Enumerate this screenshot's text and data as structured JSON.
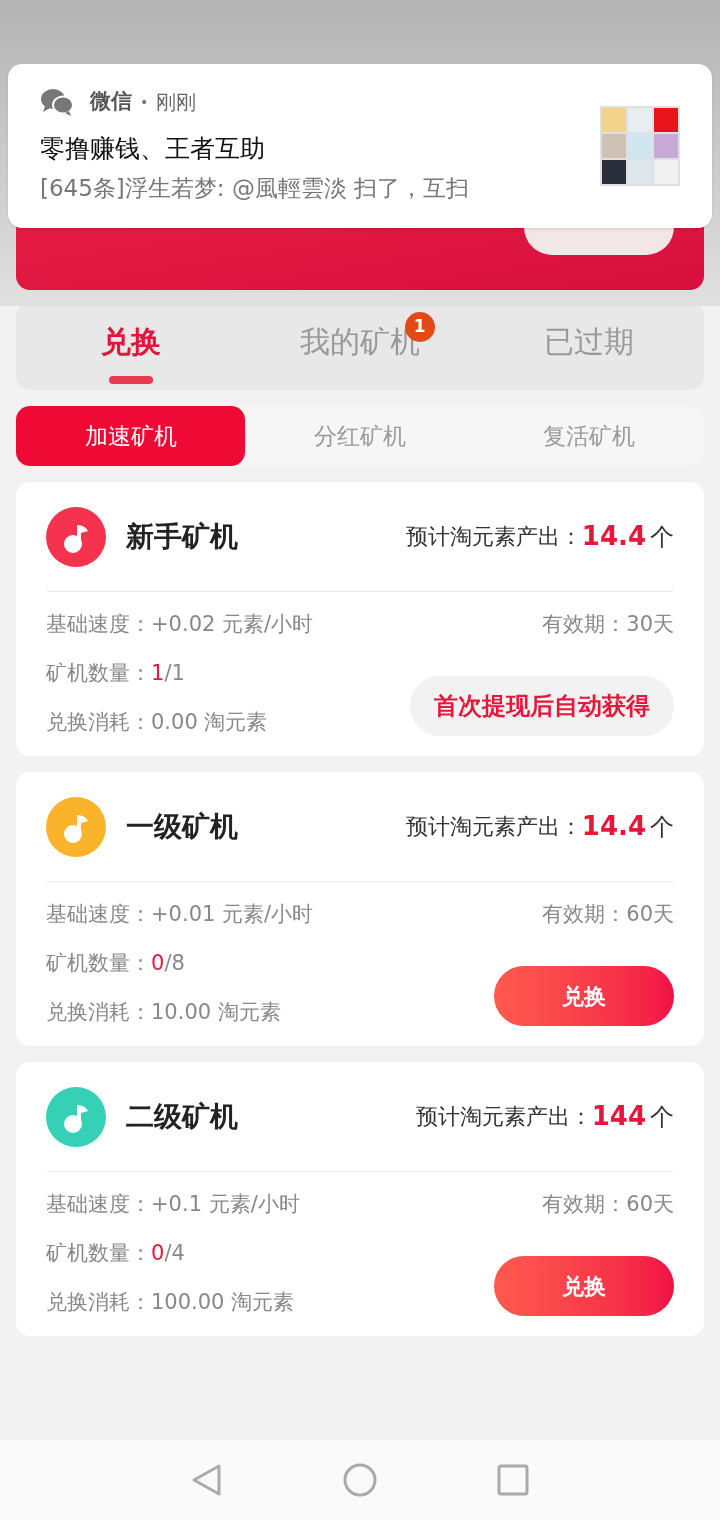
{
  "notification": {
    "app": "微信",
    "separator": "•",
    "time": "刚刚",
    "title": "零撸赚钱、王者互助",
    "message": "[645条]浮生若梦: @風輕雲淡 扫了，互扫"
  },
  "tabs": [
    {
      "label": "兑换",
      "selected": true
    },
    {
      "label": "我的矿机",
      "selected": false,
      "badge": "1"
    },
    {
      "label": "已过期",
      "selected": false
    }
  ],
  "subtabs": [
    {
      "label": "加速矿机",
      "selected": true
    },
    {
      "label": "分红矿机",
      "selected": false
    },
    {
      "label": "复活矿机",
      "selected": false
    }
  ],
  "miners": [
    {
      "color": "#f5334f",
      "name": "新手矿机",
      "output_label": "预计淘元素产出：",
      "output": "14.4",
      "output_unit": "个",
      "speed_label": "基础速度：",
      "speed": "+0.02 元素/小时",
      "validity_label": "有效期：",
      "validity": "30天",
      "count_label": "矿机数量：",
      "count_have": "1",
      "count_total": "/1",
      "cost_label": "兑换消耗：",
      "cost": "0.00 淘元素",
      "action": {
        "kind": "note",
        "label": "首次提现后自动获得"
      }
    },
    {
      "color": "#fbb32c",
      "name": "一级矿机",
      "output_label": "预计淘元素产出：",
      "output": "14.4",
      "output_unit": "个",
      "speed_label": "基础速度：",
      "speed": "+0.01 元素/小时",
      "validity_label": "有效期：",
      "validity": "60天",
      "count_label": "矿机数量：",
      "count_have": "0",
      "count_total": "/8",
      "cost_label": "兑换消耗：",
      "cost": "10.00 淘元素",
      "action": {
        "kind": "button",
        "label": "兑换"
      }
    },
    {
      "color": "#35d0b5",
      "name": "二级矿机",
      "output_label": "预计淘元素产出：",
      "output": "144",
      "output_unit": "个",
      "speed_label": "基础速度：",
      "speed": "+0.1 元素/小时",
      "validity_label": "有效期：",
      "validity": "60天",
      "count_label": "矿机数量：",
      "count_have": "0",
      "count_total": "/4",
      "cost_label": "兑换消耗：",
      "cost": "100.00 淘元素",
      "action": {
        "kind": "button",
        "label": "兑换"
      }
    }
  ]
}
